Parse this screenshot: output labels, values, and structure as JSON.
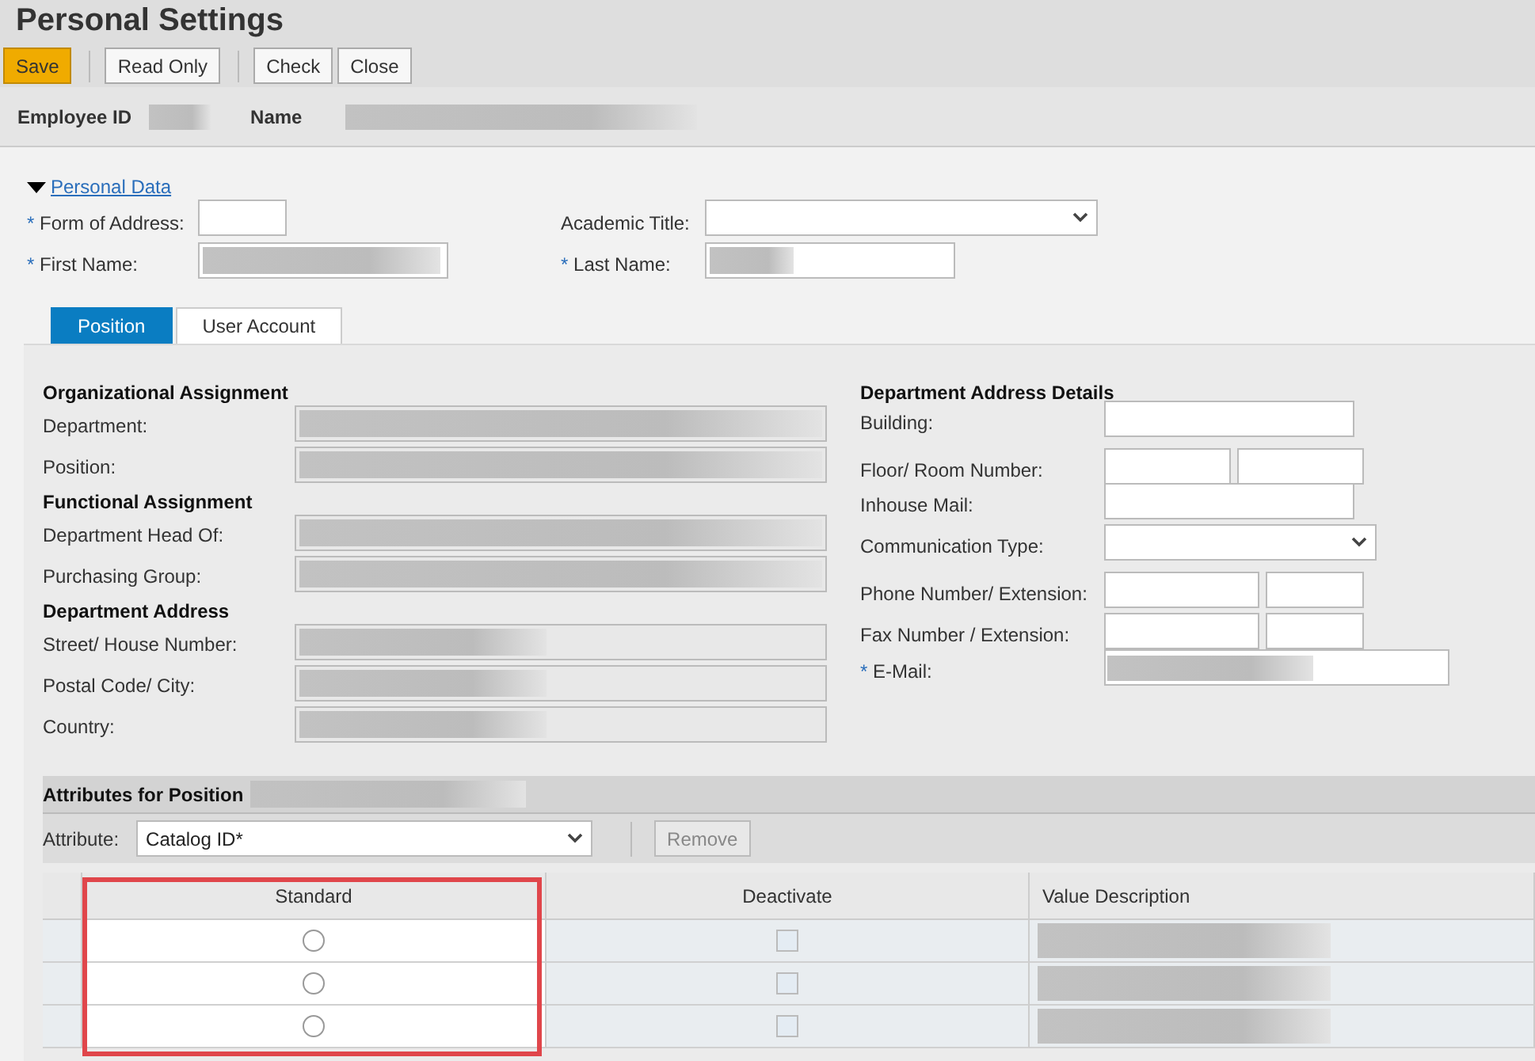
{
  "page": {
    "title": "Personal Settings"
  },
  "toolbar": [
    [
      {
        "label": "Save",
        "kind": "primary"
      }
    ],
    [
      {
        "label": "Read Only",
        "kind": "default"
      }
    ],
    [
      {
        "label": "Check",
        "kind": "default"
      },
      {
        "label": "Close",
        "kind": "default"
      }
    ]
  ],
  "header_fields": [
    {
      "label": "Employee ID"
    },
    {
      "label": "Name"
    }
  ],
  "personal_data": {
    "title": "Personal Data",
    "expanded": true,
    "left": [
      {
        "label": "Form of Address:",
        "required_mark": "*",
        "kind": "short"
      },
      {
        "label": "First Name:",
        "required_mark": "*",
        "kind": "input"
      }
    ],
    "right": [
      {
        "label": "Academic Title:",
        "kind": "select"
      },
      {
        "label": "Last Name:",
        "required_mark": "*",
        "kind": "input"
      }
    ]
  },
  "tabs": [
    {
      "label": "Position",
      "selected": true
    },
    {
      "label": "User Account",
      "selected": false
    }
  ],
  "left_sections": [
    {
      "title": "Organizational Assignment",
      "fields": [
        {
          "label": "Department:"
        },
        {
          "label": "Position:"
        }
      ]
    },
    {
      "title": "Functional Assignment",
      "fields": [
        {
          "label": "Department Head Of:"
        },
        {
          "label": "Purchasing Group:"
        }
      ]
    },
    {
      "title": "Department Address",
      "fields": [
        {
          "label": "Street/ House Number:"
        },
        {
          "label": "Postal Code/ City:"
        },
        {
          "label": "Country:"
        }
      ]
    }
  ],
  "right_section": {
    "title": "Department Address Details",
    "fields": [
      {
        "label": "Building:",
        "kind": "input"
      },
      {
        "label": "Floor/ Room Number:",
        "kind": "pair"
      },
      {
        "label": "Inhouse Mail:",
        "kind": "input"
      },
      {
        "label": "Communication Type:",
        "kind": "select"
      },
      {
        "label": "Phone Number/ Extension:",
        "kind": "pair"
      },
      {
        "label": "Fax Number / Extension:",
        "kind": "pair"
      },
      {
        "label": "E-Mail:",
        "kind": "wide",
        "required_mark": "*"
      }
    ]
  },
  "attributes": {
    "title": "Attributes for Position",
    "attribute_label": "Attribute:",
    "attribute_value": "Catalog ID*",
    "remove_button": {
      "label": "Remove",
      "disabled": true
    },
    "columns": [
      "Standard",
      "Deactivate",
      "Value Description"
    ],
    "rows": [
      {
        "selected": false,
        "checked": false
      },
      {
        "selected": false,
        "checked": false
      },
      {
        "selected": false,
        "checked": false
      }
    ]
  }
}
